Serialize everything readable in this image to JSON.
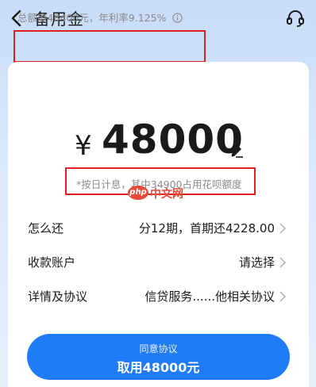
{
  "header": {
    "title": "备用金"
  },
  "quota": {
    "text": "总额度48400元，年利率9.125%"
  },
  "loan": {
    "currency_symbol": "¥",
    "amount": "48000",
    "note": "*按日计息，其中34900占用花呗额度"
  },
  "watermark": {
    "logo": "php",
    "text": "中文网"
  },
  "rows": [
    {
      "label": "怎么还",
      "value": "分12期，首期还4228.00"
    },
    {
      "label": "收款账户",
      "value": "请选择"
    },
    {
      "label": "详情及协议",
      "value": "信贷服务......他相关协议"
    }
  ],
  "cta": {
    "subtitle": "同意协议",
    "label": "取用48000元"
  },
  "colors": {
    "accent": "#1f7cf6",
    "highlight_border": "#e02020",
    "secondary_text": "#8a8a8a"
  },
  "icons": [
    "back-arrow-icon",
    "headset-icon",
    "info-icon",
    "edit-pencil-icon",
    "chevron-right-icon"
  ]
}
